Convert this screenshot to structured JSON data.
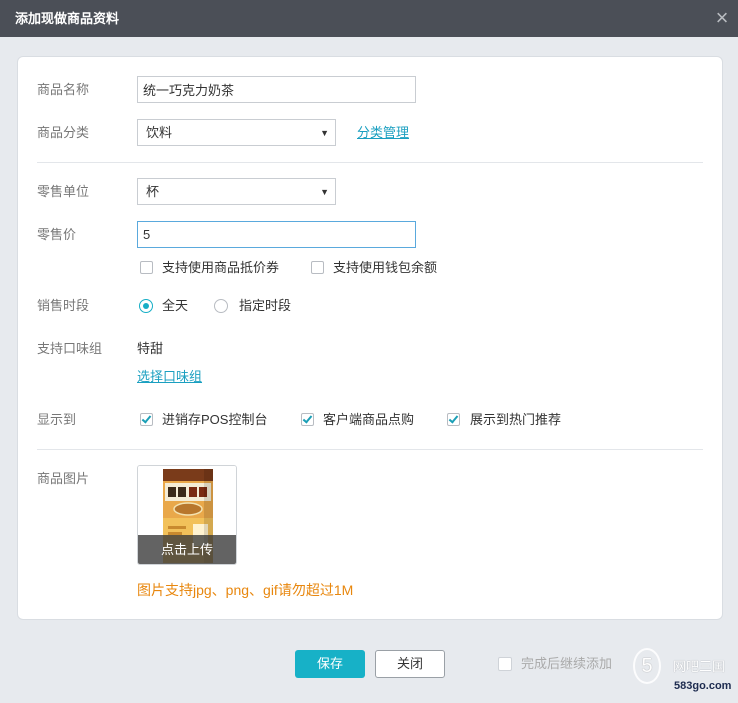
{
  "dialog": {
    "title": "添加现做商品资料",
    "close_icon": "close-icon"
  },
  "form": {
    "name": {
      "label": "商品名称",
      "value": "统一巧克力奶茶"
    },
    "category": {
      "label": "商品分类",
      "value": "饮料",
      "arrow_icon": "caret-down-icon",
      "manage_link": "分类管理"
    },
    "unit": {
      "label": "零售单位",
      "value": "杯",
      "arrow_icon": "caret-down-icon"
    },
    "price": {
      "label": "零售价",
      "value": "5",
      "options": [
        {
          "label": "支持使用商品抵价券",
          "checked": false
        },
        {
          "label": "支持使用钱包余额",
          "checked": false
        }
      ]
    },
    "sale_period": {
      "label": "销售时段",
      "options": [
        {
          "label": "全天",
          "selected": true
        },
        {
          "label": "指定时段",
          "selected": false
        }
      ]
    },
    "flavor": {
      "label": "支持口味组",
      "value": "特甜",
      "link": "选择口味组"
    },
    "display": {
      "label": "显示到",
      "options": [
        {
          "label": "进销存POS控制台",
          "checked": true
        },
        {
          "label": "客户端商品点购",
          "checked": true
        },
        {
          "label": "展示到热门推荐",
          "checked": true
        }
      ]
    },
    "image": {
      "label": "商品图片",
      "thumbnail": "milk-tea-carton-image",
      "upload_label": "点击上传",
      "hint": "图片支持jpg、png、gif请勿超过1M"
    }
  },
  "footer": {
    "save_label": "保存",
    "close_label": "关闭",
    "continue": {
      "label": "完成后继续添加",
      "checked": false
    }
  },
  "watermark": {
    "logo_digit": "5",
    "text": "网吧三国",
    "site": "583go.com"
  },
  "colors": {
    "title_bar": "#4b4f57",
    "accent": "#17b1c7",
    "link": "#1a9fc0",
    "hint": "#e8870e",
    "focus_border": "#5aa9dd"
  }
}
